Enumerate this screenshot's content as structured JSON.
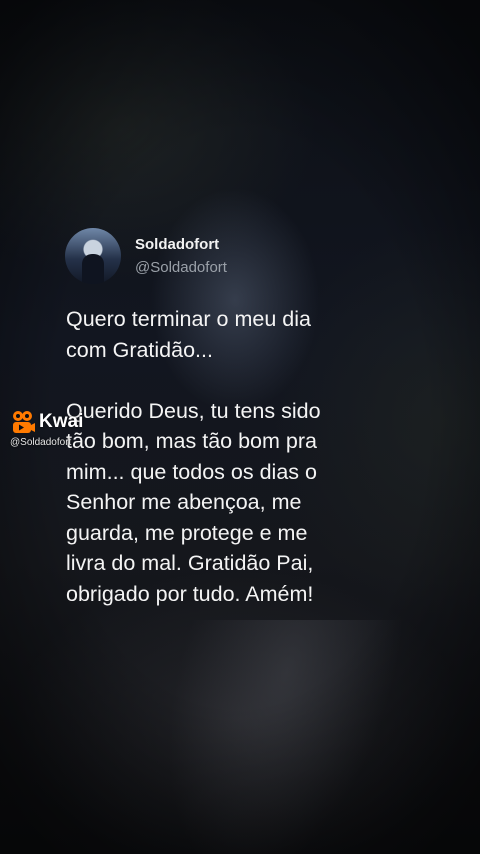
{
  "tweet": {
    "display_name": "Soldadofort",
    "handle": "@Soldadofort",
    "body": "Quero terminar o meu dia\ncom Gratidão...\n\nQuerido Deus, tu tens sido\ntão bom, mas tão bom pra\nmim... que todos os dias o\nSenhor  me abençoa, me\nguarda, me protege e me\nlivra do mal. Gratidão Pai,\nobrigado por tudo. Amém!"
  },
  "watermark": {
    "brand": "Kwai",
    "handle": "@Soldadofort",
    "logo_color": "#ff7a00",
    "icon": "kwai-logo-icon"
  }
}
